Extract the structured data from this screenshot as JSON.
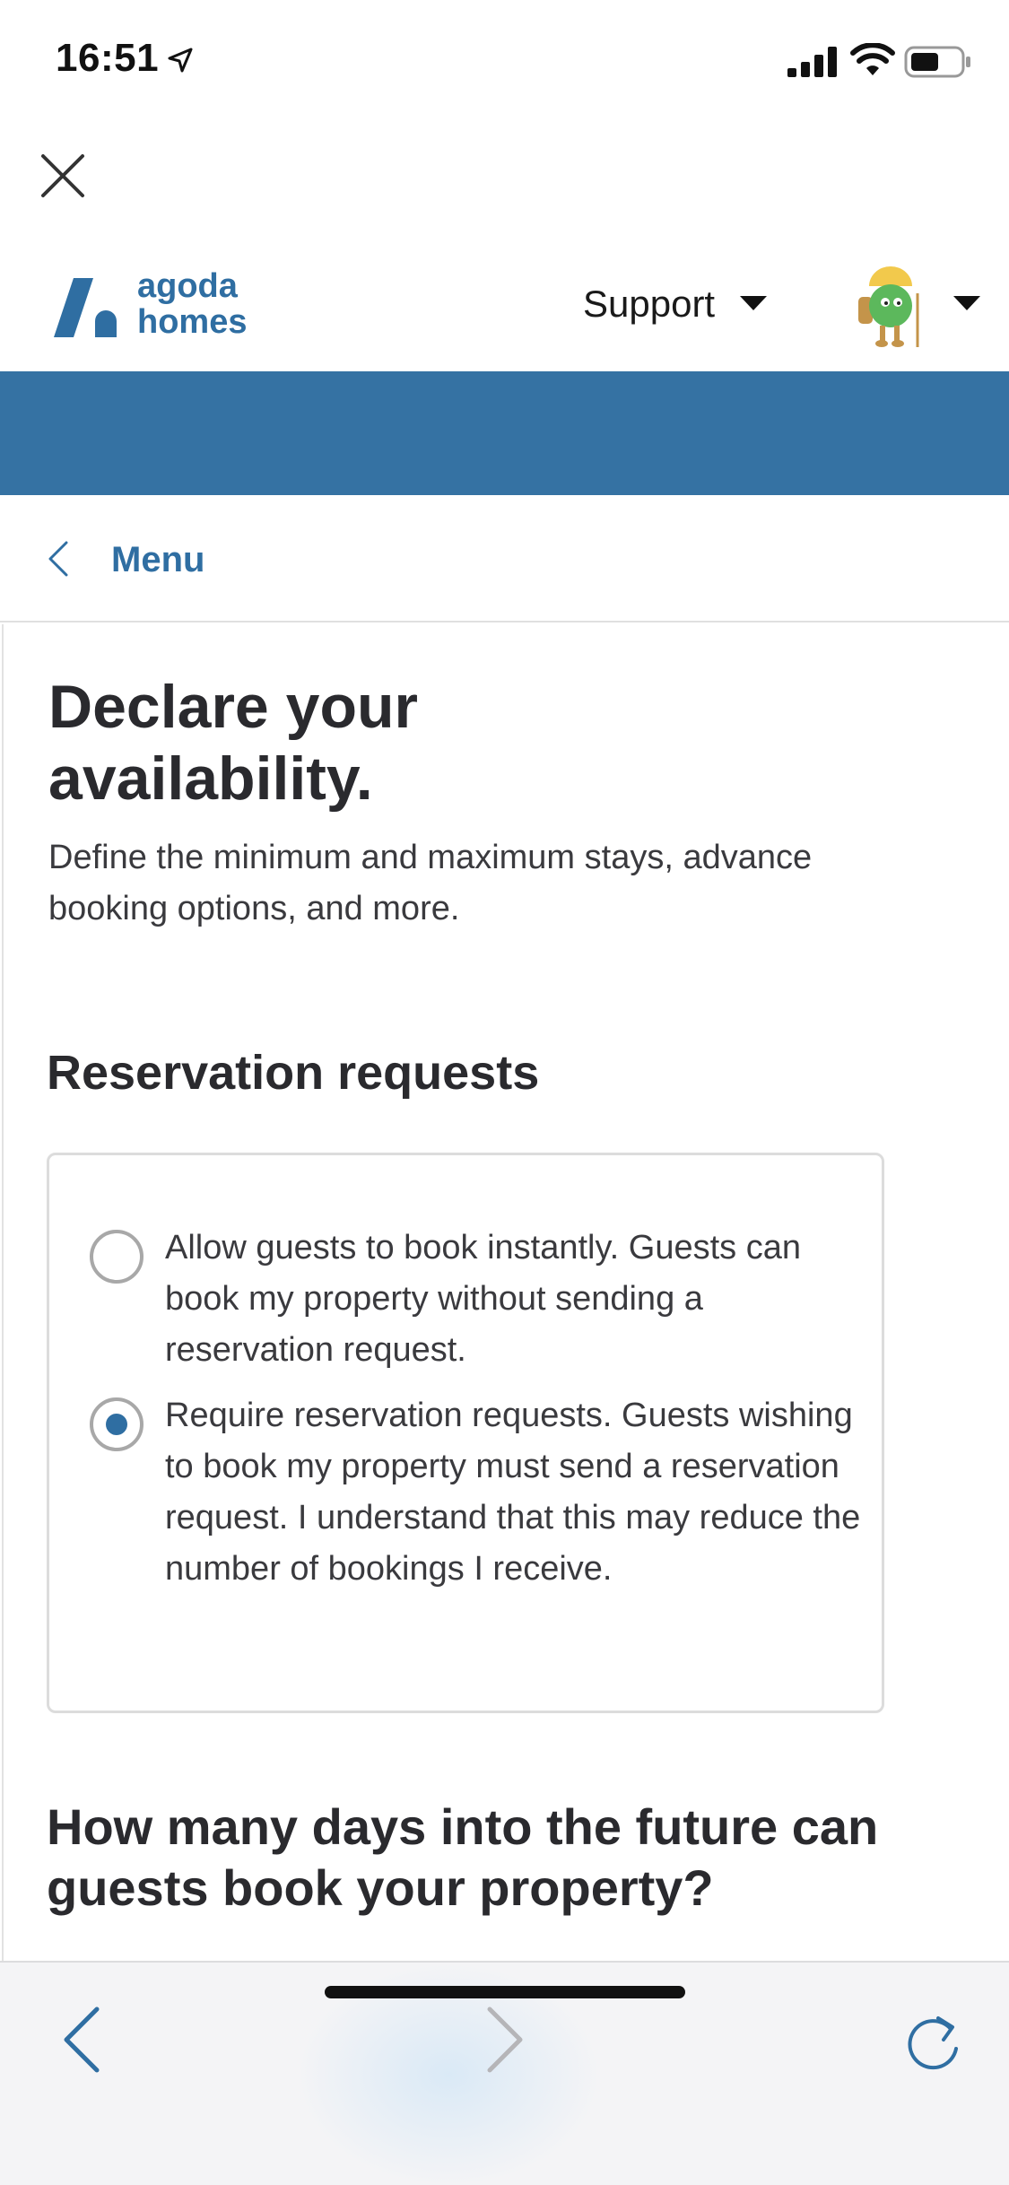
{
  "status_bar": {
    "time": "16:51",
    "icons": [
      "location-arrow-icon",
      "cellular-signal-icon",
      "wifi-icon",
      "battery-icon"
    ]
  },
  "header": {
    "logo_line1": "agoda",
    "logo_line2": "homes",
    "support_label": "Support",
    "brand_color": "#2f6ea2",
    "band_color": "#3572a3"
  },
  "menu": {
    "label": "Menu"
  },
  "main": {
    "title": "Declare your availability.",
    "description": "Define the minimum and maximum stays, advance booking options, and more.",
    "reservation_section_title": "Reservation requests",
    "options": [
      {
        "label": "Allow guests to book instantly. Guests can book my property without sending a reservation request.",
        "selected": false
      },
      {
        "label": "Require reservation requests. Guests wishing to book my property must send a reservation request. I understand that this may reduce the number of bookings I receive.",
        "selected": true
      }
    ],
    "future_section_title": "How many days into the future can guests book your property?"
  },
  "browser_toolbar": {
    "icons": [
      "back-arrow-icon",
      "forward-arrow-icon",
      "reload-icon"
    ]
  }
}
